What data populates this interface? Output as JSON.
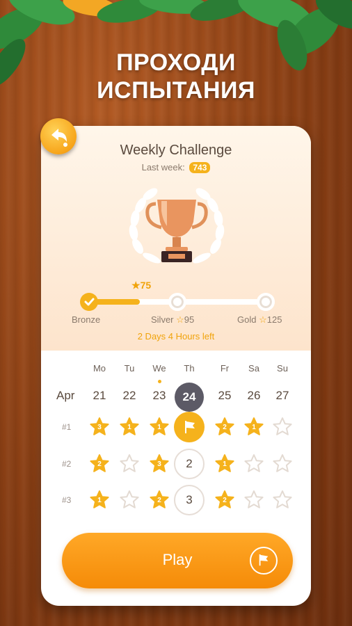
{
  "headline_line1": "ПРОХОДИ",
  "headline_line2": "ИСПЫТАНИЯ",
  "back_icon": "undo-arrow-icon",
  "card": {
    "title": "Weekly Challenge",
    "last_week_label": "Last week:",
    "last_week_value": "743",
    "trophy_icon": "trophy-laurel-icon",
    "progress": {
      "score": "75",
      "fraction": 0.29,
      "bronze_label": "Bronze",
      "silver_label": "Silver",
      "silver_value": "95",
      "gold_label": "Gold",
      "gold_value": "125",
      "time_left": "2 Days 4 Hours left"
    },
    "calendar": {
      "month": "Apr",
      "days": [
        {
          "dow": "Mo",
          "date": "21"
        },
        {
          "dow": "Tu",
          "date": "22"
        },
        {
          "dow": "We",
          "date": "23"
        },
        {
          "dow": "Th",
          "date": "24",
          "today": true
        },
        {
          "dow": "Fr",
          "date": "25"
        },
        {
          "dow": "Sa",
          "date": "26"
        },
        {
          "dow": "Su",
          "date": "27"
        }
      ],
      "rows": [
        {
          "label": "#1",
          "cells": [
            "3",
            "1",
            "1",
            "flag",
            "2",
            "1",
            "empty"
          ]
        },
        {
          "label": "#2",
          "cells": [
            "2",
            "empty",
            "3",
            "2",
            "1",
            "empty",
            "empty"
          ]
        },
        {
          "label": "#3",
          "cells": [
            "1",
            "empty",
            "2",
            "3",
            "2",
            "empty",
            "empty"
          ]
        }
      ]
    },
    "play_label": "Play",
    "play_icon": "flag-icon"
  },
  "colors": {
    "accent": "#f5b21c",
    "play": "#f58b08",
    "today": "#5c5a66"
  }
}
